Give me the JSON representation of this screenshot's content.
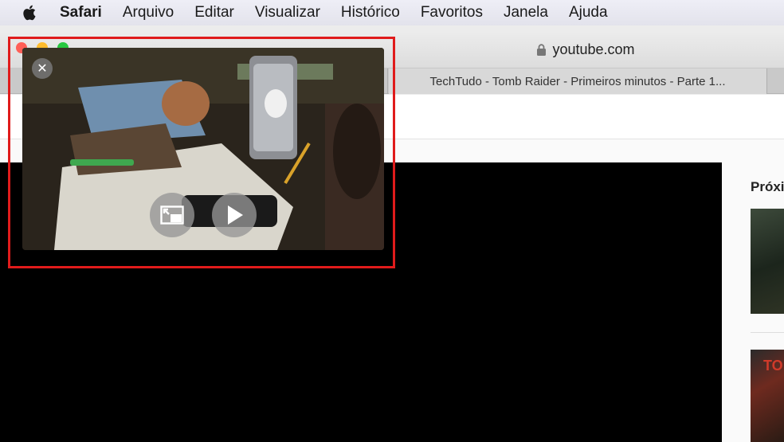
{
  "menubar": {
    "app_name": "Safari",
    "items": [
      "Arquivo",
      "Editar",
      "Visualizar",
      "Histórico",
      "Favoritos",
      "Janela",
      "Ajuda"
    ]
  },
  "toolbar": {
    "address": "youtube.com"
  },
  "tabs": [
    {
      "label": ""
    },
    {
      "label": "TechTudo - Tomb Raider - Primeiros minutos - Parte 1..."
    },
    {
      "label": ""
    }
  ],
  "sidebar": {
    "title": "Próxi",
    "thumb2_text": "TO"
  },
  "pip": {
    "close_symbol": "✕"
  },
  "colors": {
    "highlight": "#e01b1b",
    "close": "#ff5f57",
    "minimize": "#febc2e",
    "zoom": "#28c840"
  }
}
